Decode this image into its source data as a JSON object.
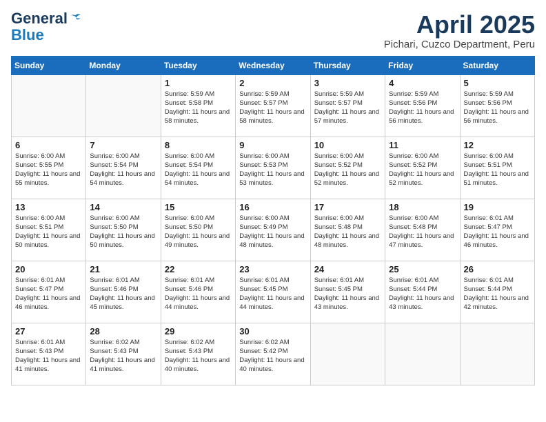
{
  "logo": {
    "general": "General",
    "blue": "Blue"
  },
  "title": {
    "month_year": "April 2025",
    "location": "Pichari, Cuzco Department, Peru"
  },
  "weekdays": [
    "Sunday",
    "Monday",
    "Tuesday",
    "Wednesday",
    "Thursday",
    "Friday",
    "Saturday"
  ],
  "weeks": [
    [
      {
        "day": "",
        "detail": ""
      },
      {
        "day": "",
        "detail": ""
      },
      {
        "day": "1",
        "detail": "Sunrise: 5:59 AM\nSunset: 5:58 PM\nDaylight: 11 hours and 58 minutes."
      },
      {
        "day": "2",
        "detail": "Sunrise: 5:59 AM\nSunset: 5:57 PM\nDaylight: 11 hours and 58 minutes."
      },
      {
        "day": "3",
        "detail": "Sunrise: 5:59 AM\nSunset: 5:57 PM\nDaylight: 11 hours and 57 minutes."
      },
      {
        "day": "4",
        "detail": "Sunrise: 5:59 AM\nSunset: 5:56 PM\nDaylight: 11 hours and 56 minutes."
      },
      {
        "day": "5",
        "detail": "Sunrise: 5:59 AM\nSunset: 5:56 PM\nDaylight: 11 hours and 56 minutes."
      }
    ],
    [
      {
        "day": "6",
        "detail": "Sunrise: 6:00 AM\nSunset: 5:55 PM\nDaylight: 11 hours and 55 minutes."
      },
      {
        "day": "7",
        "detail": "Sunrise: 6:00 AM\nSunset: 5:54 PM\nDaylight: 11 hours and 54 minutes."
      },
      {
        "day": "8",
        "detail": "Sunrise: 6:00 AM\nSunset: 5:54 PM\nDaylight: 11 hours and 54 minutes."
      },
      {
        "day": "9",
        "detail": "Sunrise: 6:00 AM\nSunset: 5:53 PM\nDaylight: 11 hours and 53 minutes."
      },
      {
        "day": "10",
        "detail": "Sunrise: 6:00 AM\nSunset: 5:52 PM\nDaylight: 11 hours and 52 minutes."
      },
      {
        "day": "11",
        "detail": "Sunrise: 6:00 AM\nSunset: 5:52 PM\nDaylight: 11 hours and 52 minutes."
      },
      {
        "day": "12",
        "detail": "Sunrise: 6:00 AM\nSunset: 5:51 PM\nDaylight: 11 hours and 51 minutes."
      }
    ],
    [
      {
        "day": "13",
        "detail": "Sunrise: 6:00 AM\nSunset: 5:51 PM\nDaylight: 11 hours and 50 minutes."
      },
      {
        "day": "14",
        "detail": "Sunrise: 6:00 AM\nSunset: 5:50 PM\nDaylight: 11 hours and 50 minutes."
      },
      {
        "day": "15",
        "detail": "Sunrise: 6:00 AM\nSunset: 5:50 PM\nDaylight: 11 hours and 49 minutes."
      },
      {
        "day": "16",
        "detail": "Sunrise: 6:00 AM\nSunset: 5:49 PM\nDaylight: 11 hours and 48 minutes."
      },
      {
        "day": "17",
        "detail": "Sunrise: 6:00 AM\nSunset: 5:48 PM\nDaylight: 11 hours and 48 minutes."
      },
      {
        "day": "18",
        "detail": "Sunrise: 6:00 AM\nSunset: 5:48 PM\nDaylight: 11 hours and 47 minutes."
      },
      {
        "day": "19",
        "detail": "Sunrise: 6:01 AM\nSunset: 5:47 PM\nDaylight: 11 hours and 46 minutes."
      }
    ],
    [
      {
        "day": "20",
        "detail": "Sunrise: 6:01 AM\nSunset: 5:47 PM\nDaylight: 11 hours and 46 minutes."
      },
      {
        "day": "21",
        "detail": "Sunrise: 6:01 AM\nSunset: 5:46 PM\nDaylight: 11 hours and 45 minutes."
      },
      {
        "day": "22",
        "detail": "Sunrise: 6:01 AM\nSunset: 5:46 PM\nDaylight: 11 hours and 44 minutes."
      },
      {
        "day": "23",
        "detail": "Sunrise: 6:01 AM\nSunset: 5:45 PM\nDaylight: 11 hours and 44 minutes."
      },
      {
        "day": "24",
        "detail": "Sunrise: 6:01 AM\nSunset: 5:45 PM\nDaylight: 11 hours and 43 minutes."
      },
      {
        "day": "25",
        "detail": "Sunrise: 6:01 AM\nSunset: 5:44 PM\nDaylight: 11 hours and 43 minutes."
      },
      {
        "day": "26",
        "detail": "Sunrise: 6:01 AM\nSunset: 5:44 PM\nDaylight: 11 hours and 42 minutes."
      }
    ],
    [
      {
        "day": "27",
        "detail": "Sunrise: 6:01 AM\nSunset: 5:43 PM\nDaylight: 11 hours and 41 minutes."
      },
      {
        "day": "28",
        "detail": "Sunrise: 6:02 AM\nSunset: 5:43 PM\nDaylight: 11 hours and 41 minutes."
      },
      {
        "day": "29",
        "detail": "Sunrise: 6:02 AM\nSunset: 5:43 PM\nDaylight: 11 hours and 40 minutes."
      },
      {
        "day": "30",
        "detail": "Sunrise: 6:02 AM\nSunset: 5:42 PM\nDaylight: 11 hours and 40 minutes."
      },
      {
        "day": "",
        "detail": ""
      },
      {
        "day": "",
        "detail": ""
      },
      {
        "day": "",
        "detail": ""
      }
    ]
  ]
}
